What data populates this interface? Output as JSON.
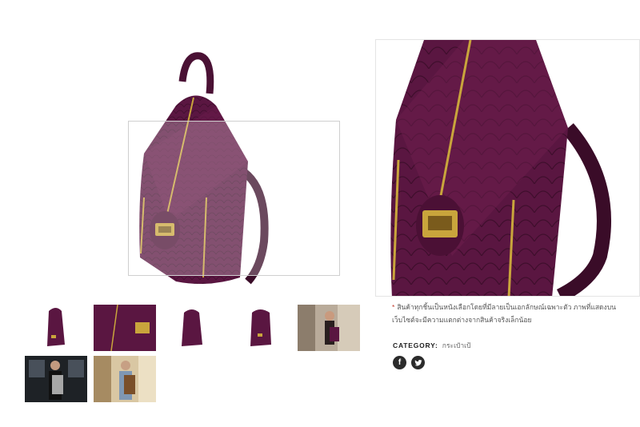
{
  "product": {
    "note": "สินค้าทุกชิ้นเป็นหนังเลือกโดยที่มีลายเป็นเอกลักษณ์เฉพาะตัว ภาพที่แสดงบนเว็บไซต์จะมีความแตกต่างจากสินค้าจริงเล็กน้อย",
    "category_label": "CATEGORY:",
    "category_value": "กระเป๋าเป้"
  },
  "thumbnails": [
    {
      "name": "front"
    },
    {
      "name": "detail-closeup"
    },
    {
      "name": "back"
    },
    {
      "name": "side"
    },
    {
      "name": "model-woman"
    },
    {
      "name": "model-man-silver"
    },
    {
      "name": "model-man-brown"
    }
  ],
  "social": {
    "facebook_glyph": "f",
    "twitter_glyph": "t"
  },
  "colors": {
    "leather": "#5c1740",
    "leather_dark": "#3d0d29",
    "zipper": "#c9a53c",
    "zoom_border": "#cfcfcf"
  }
}
